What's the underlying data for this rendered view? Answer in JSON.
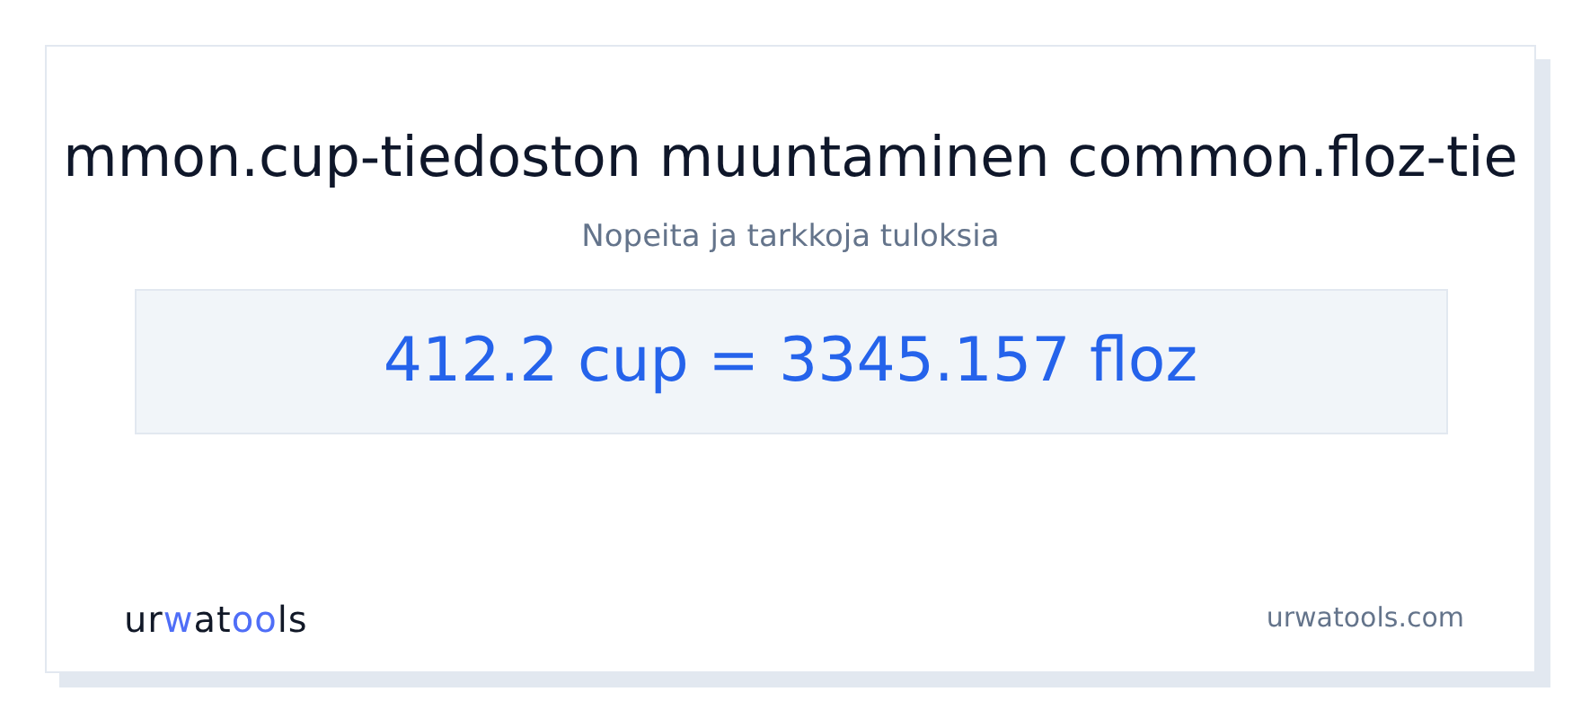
{
  "title": "mmon.cup-tiedoston muuntaminen common.floz-tie",
  "subtitle": "Nopeita ja tarkkoja tuloksia",
  "result": "412.2 cup = 3345.157 floz",
  "logo": [
    {
      "text": "ur",
      "accent": false
    },
    {
      "text": "w",
      "accent": true
    },
    {
      "text": "at",
      "accent": false
    },
    {
      "text": "oo",
      "accent": true
    },
    {
      "text": "ls",
      "accent": false
    }
  ],
  "domain": "urwatools.com"
}
